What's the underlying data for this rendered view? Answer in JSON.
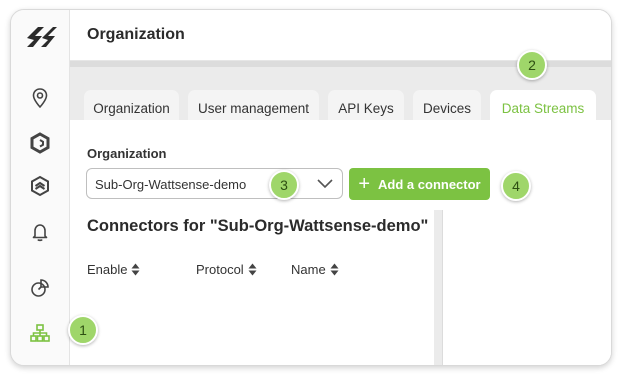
{
  "header": {
    "title": "Organization"
  },
  "sidebar": {
    "items": [
      {
        "icon": "location-pin-icon",
        "name": "sidebar-item-location"
      },
      {
        "icon": "hexagon-icon",
        "name": "sidebar-item-devices"
      },
      {
        "icon": "layers-icon",
        "name": "sidebar-item-layers"
      },
      {
        "icon": "bell-icon",
        "name": "sidebar-item-alerts"
      },
      {
        "icon": "analytics-icon",
        "name": "sidebar-item-analytics"
      },
      {
        "icon": "org-tree-icon",
        "name": "sidebar-item-organization",
        "active": true
      }
    ]
  },
  "tabs": [
    {
      "label": "Organization"
    },
    {
      "label": "User management"
    },
    {
      "label": "API Keys"
    },
    {
      "label": "Devices"
    },
    {
      "label": "Data Streams",
      "active": true
    }
  ],
  "content": {
    "org_label": "Organization",
    "org_select_value": "Sub-Org-Wattsense-demo",
    "add_connector_label": "Add a connector",
    "connectors_title": "Connectors for \"Sub-Org-Wattsense-demo\"",
    "columns": [
      "Enable",
      "Protocol",
      "Name"
    ]
  },
  "markers": [
    "1",
    "2",
    "3",
    "4"
  ],
  "colors": {
    "accent": "#7cc242",
    "marker": "#9fd66a"
  }
}
